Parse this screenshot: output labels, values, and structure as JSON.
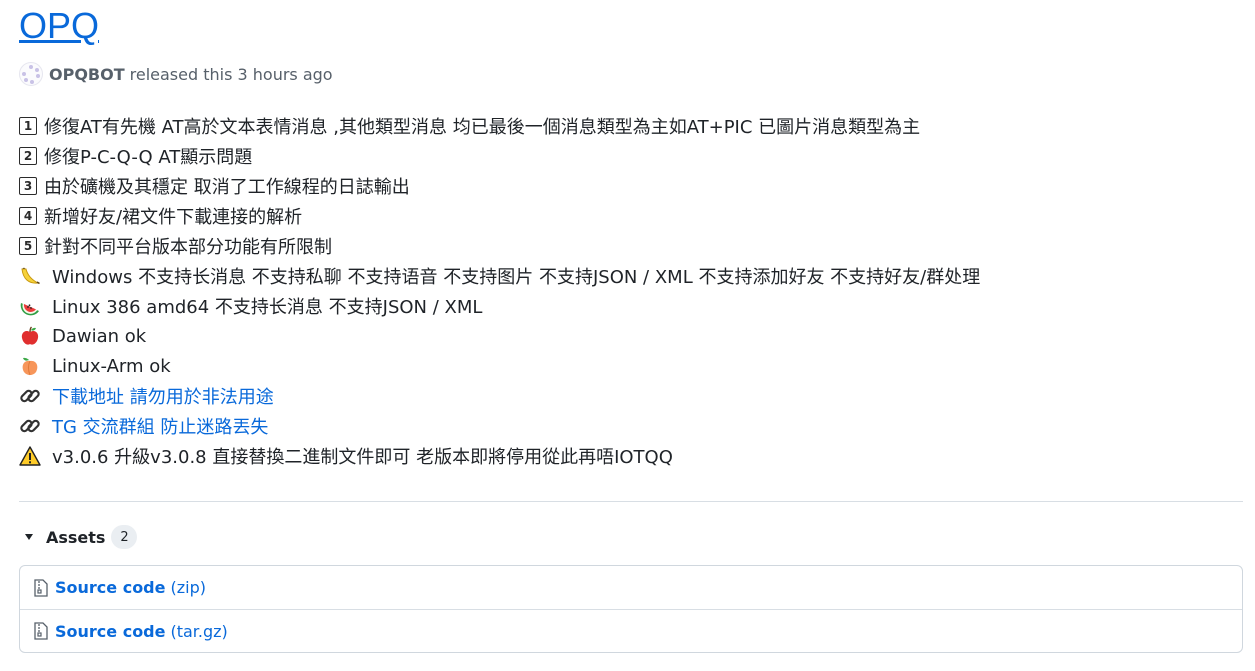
{
  "release": {
    "title": "OPQ",
    "author": "OPQBOT",
    "released_text": "released this 3 hours ago"
  },
  "notes": [
    {
      "icon": "keycap-1-icon",
      "marker": "1",
      "text": "修復AT有先機 AT高於文本表情消息 ,其他類型消息 均已最後一個消息類型為主如AT+PIC 已圖片消息類型為主"
    },
    {
      "icon": "keycap-2-icon",
      "marker": "2",
      "text": "修復P-C-Q-Q AT顯示問題"
    },
    {
      "icon": "keycap-3-icon",
      "marker": "3",
      "text": "由於礦機及其穩定 取消了工作線程的日誌輸出"
    },
    {
      "icon": "keycap-4-icon",
      "marker": "4",
      "text": "新增好友/裙文件下載連接的解析"
    },
    {
      "icon": "keycap-5-icon",
      "marker": "5",
      "text": "針對不同平台版本部分功能有所限制"
    },
    {
      "icon": "banana-icon",
      "text": "Windows 不支持长消息 不支持私聊 不支持语音 不支持图片 不支持JSON / XML 不支持添加好友 不支持好友/群处理"
    },
    {
      "icon": "watermelon-icon",
      "text": "Linux 386 amd64 不支持长消息 不支持JSON / XML"
    },
    {
      "icon": "apple-icon",
      "text": "Dawian ok"
    },
    {
      "icon": "peach-icon",
      "text": "Linux-Arm ok"
    },
    {
      "icon": "link-icon",
      "text": "下載地址 請勿用於非法用途"
    },
    {
      "icon": "link-icon",
      "text": "TG 交流群組 防止迷路丟失"
    },
    {
      "icon": "warning-icon",
      "text": "v3.0.6 升級v3.0.8 直接替換二進制文件即可 老版本即將停用從此再唔IOTQQ"
    }
  ],
  "assets": {
    "label": "Assets",
    "count": "2",
    "items": [
      {
        "name": "Source code",
        "ext": "(zip)"
      },
      {
        "name": "Source code",
        "ext": "(tar.gz)"
      }
    ]
  },
  "colors": {
    "link": "#0969da",
    "text": "#1f2328",
    "muted": "#57606a",
    "border": "#d0d7de"
  }
}
